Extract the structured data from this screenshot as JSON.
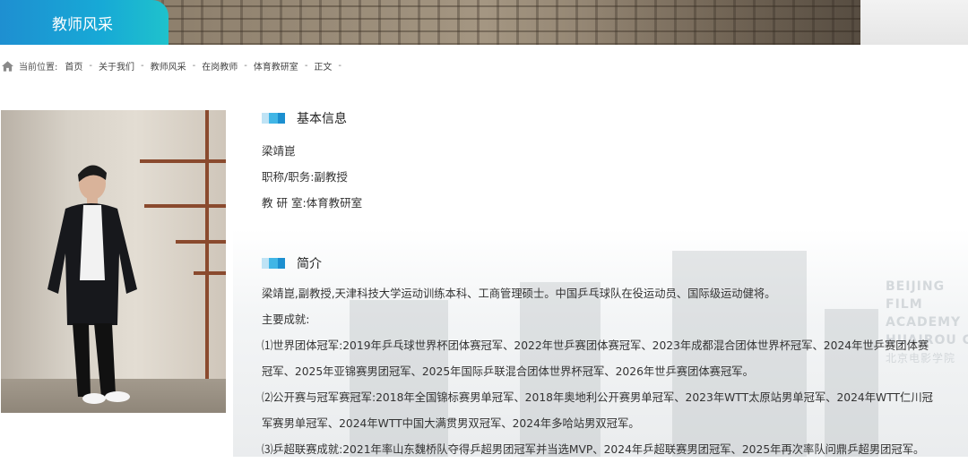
{
  "banner": {
    "title": "教师风采"
  },
  "breadcrumb": {
    "label": "当前位置:",
    "items": [
      "首页",
      "关于我们",
      "教师风采",
      "在岗教师",
      "体育教研室",
      "正文"
    ],
    "separator": "-"
  },
  "watermark": {
    "lines": [
      "BEIJING",
      "FILM",
      "ACADEMY",
      "HUAIROU CA"
    ],
    "cn": "北京电影学院"
  },
  "basic_info": {
    "heading": "基本信息",
    "name": "梁靖崑",
    "title_line": "职称/职务:副教授",
    "dept_line": "教 研 室:体育教研室"
  },
  "intro": {
    "heading": "简介",
    "p1": "梁靖崑,副教授,天津科技大学运动训练本科、工商管理硕士。中国乒乓球队在役运动员、国际级运动健将。",
    "p2": "主要成就:",
    "p3a": "⑴世界团体冠军:2019年乒乓球世界杯团体赛冠军、2022年世乒赛团体赛冠军、2023年成都混合团体世界杯冠军、2024年世乒赛团体赛",
    "p3b": "冠军、2025年亚锦赛男团冠军、2025年国际乒联混合团体世界杯冠军、2026年世乒赛团体赛冠军。",
    "p4a": "⑵公开赛与冠军赛冠军:2018年全国锦标赛男单冠军、2018年奥地利公开赛男单冠军、2023年WTT太原站男单冠军、2024年WTT仁川冠",
    "p4b": "军赛男单冠军、2024年WTT中国大满贯男双冠军、2024年多哈站男双冠军。",
    "p5": "⑶乒超联赛成就:2021年率山东魏桥队夺得乒超男团冠军并当选MVP、2024年乒超联赛男团冠军、2025年再次率队问鼎乒超男团冠军。"
  },
  "colors": {
    "accent": "#1e8fd1",
    "accent2": "#1fc2cc"
  }
}
